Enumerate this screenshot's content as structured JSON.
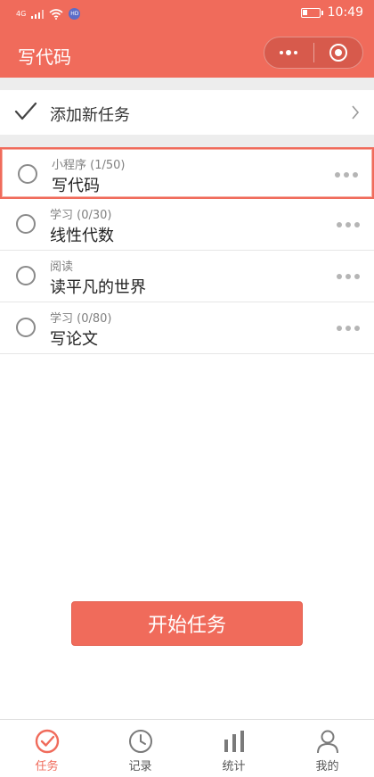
{
  "status_bar": {
    "network": "4G",
    "wifi_badge": "HD",
    "time": "10:49"
  },
  "nav": {
    "title": "写代码"
  },
  "add_task": {
    "label": "添加新任务"
  },
  "tasks": [
    {
      "subtitle": "小程序 (1/50)",
      "title": "写代码",
      "selected": true
    },
    {
      "subtitle": "学习 (0/30)",
      "title": "线性代数",
      "selected": false
    },
    {
      "subtitle": "阅读",
      "title": "读平凡的世界",
      "selected": false
    },
    {
      "subtitle": "学习 (0/80)",
      "title": "写论文",
      "selected": false
    }
  ],
  "start_button": {
    "label": "开始任务"
  },
  "tabbar": {
    "items": [
      {
        "label": "任务",
        "icon": "check-circle-icon",
        "active": true
      },
      {
        "label": "记录",
        "icon": "clock-icon",
        "active": false
      },
      {
        "label": "统计",
        "icon": "bar-chart-icon",
        "active": false
      },
      {
        "label": "我的",
        "icon": "user-icon",
        "active": false
      }
    ]
  },
  "colors": {
    "accent": "#f06b5b",
    "background": "#ffffff",
    "divider": "#ededed"
  }
}
